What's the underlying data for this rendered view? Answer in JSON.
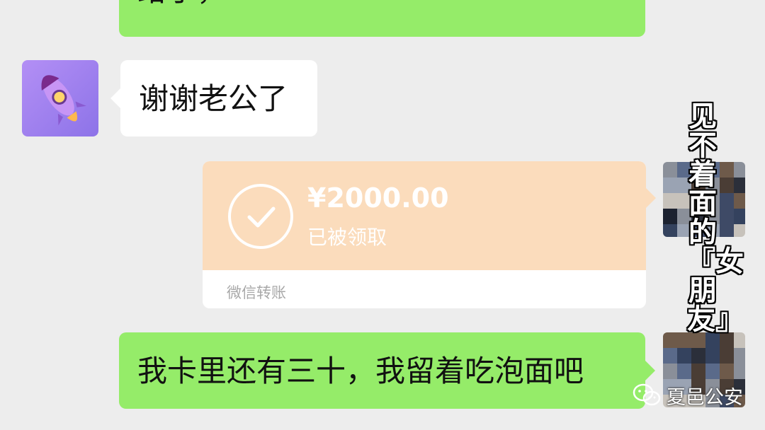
{
  "messages": {
    "top_partial": "给了，",
    "thanks": "谢谢老公了",
    "bottom": "我卡里还有三十，我留着吃泡面吧"
  },
  "transfer": {
    "amount": "¥2000.00",
    "status": "已被领取",
    "label": "微信转账"
  },
  "caption": "见不着面的『女朋友』",
  "watermark": {
    "text": "夏邑公安",
    "icon": "wechat-icon"
  },
  "colors": {
    "background": "#ededed",
    "sent_bubble": "#95ec69",
    "received_bubble": "#ffffff",
    "transfer_card": "#fbdcbc"
  }
}
